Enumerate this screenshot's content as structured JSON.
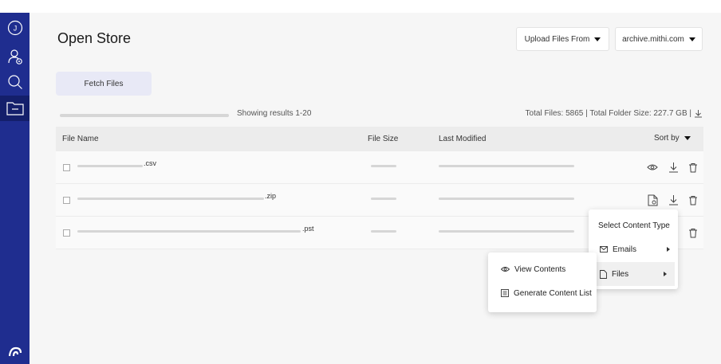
{
  "sidebar": {
    "avatar_initial": "J",
    "icons": [
      "user-icon",
      "user-settings-icon",
      "search-icon",
      "folder-icon",
      "logo-icon"
    ]
  },
  "header": {
    "title": "Open Store",
    "upload_label": "Upload Files From",
    "server_label": "archive.mithi.com"
  },
  "toolbar": {
    "fetch_label": "Fetch Files",
    "results_text": "Showing results 1-20",
    "totals_text": "Total Files: 5865 | Total Folder Size: 227.7 GB |"
  },
  "table": {
    "columns": {
      "name": "File Name",
      "size": "File Size",
      "modified": "Last Modified",
      "sort": "Sort by"
    },
    "rows": [
      {
        "ext": ".csv"
      },
      {
        "ext": ".zip"
      },
      {
        "ext": ".pst"
      }
    ]
  },
  "content_type_menu": {
    "title": "Select Content Type",
    "items": [
      "Emails",
      "Files"
    ]
  },
  "files_submenu": {
    "items": [
      "View Contents",
      "Generate Content List"
    ]
  },
  "colors": {
    "sidebar": "#1f2d8f",
    "fetch_button": "#e8e9f6",
    "menu_highlight": "#f0f0f0"
  }
}
